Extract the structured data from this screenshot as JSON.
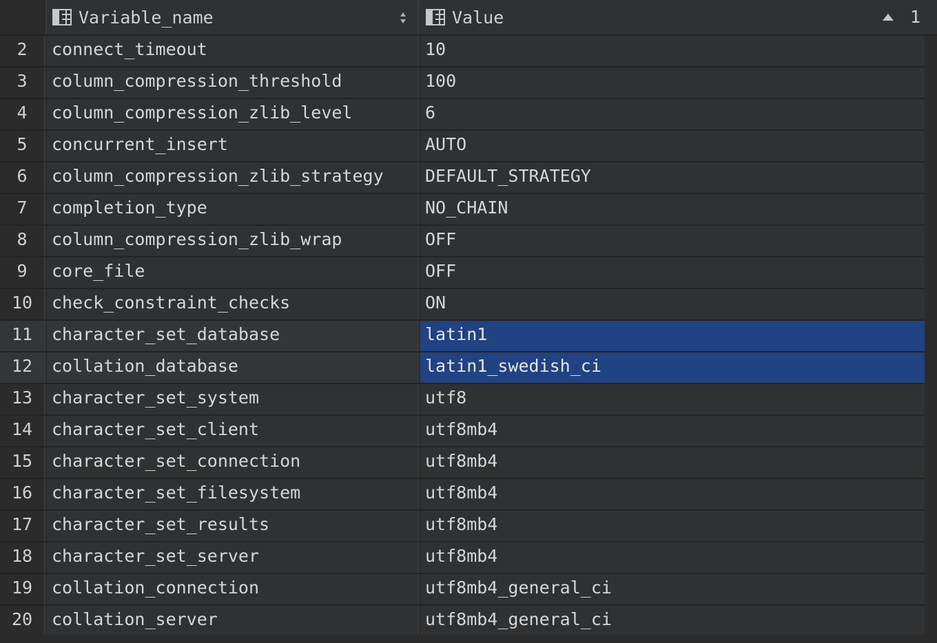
{
  "columns": {
    "name": {
      "label": "Variable_name",
      "icon": "table-column-icon"
    },
    "value": {
      "label": "Value",
      "icon": "table-column-icon",
      "sort_rank": "1",
      "sort_direction": "ascending"
    }
  },
  "colors": {
    "background": "#2b2b2b",
    "cell": "#2f3133",
    "selection": "#214283",
    "text": "#d6d6d6"
  },
  "rows": [
    {
      "num": "2",
      "name": "connect_timeout",
      "value": "10",
      "selected": false
    },
    {
      "num": "3",
      "name": "column_compression_threshold",
      "value": "100",
      "selected": false
    },
    {
      "num": "4",
      "name": "column_compression_zlib_level",
      "value": "6",
      "selected": false
    },
    {
      "num": "5",
      "name": "concurrent_insert",
      "value": "AUTO",
      "selected": false
    },
    {
      "num": "6",
      "name": "column_compression_zlib_strategy",
      "value": "DEFAULT_STRATEGY",
      "selected": false
    },
    {
      "num": "7",
      "name": "completion_type",
      "value": "NO_CHAIN",
      "selected": false
    },
    {
      "num": "8",
      "name": "column_compression_zlib_wrap",
      "value": "OFF",
      "selected": false
    },
    {
      "num": "9",
      "name": "core_file",
      "value": "OFF",
      "selected": false
    },
    {
      "num": "10",
      "name": "check_constraint_checks",
      "value": "ON",
      "selected": false
    },
    {
      "num": "11",
      "name": "character_set_database",
      "value": "latin1",
      "selected": true
    },
    {
      "num": "12",
      "name": "collation_database",
      "value": "latin1_swedish_ci",
      "selected": true
    },
    {
      "num": "13",
      "name": "character_set_system",
      "value": "utf8",
      "selected": false
    },
    {
      "num": "14",
      "name": "character_set_client",
      "value": "utf8mb4",
      "selected": false
    },
    {
      "num": "15",
      "name": "character_set_connection",
      "value": "utf8mb4",
      "selected": false
    },
    {
      "num": "16",
      "name": "character_set_filesystem",
      "value": "utf8mb4",
      "selected": false
    },
    {
      "num": "17",
      "name": "character_set_results",
      "value": "utf8mb4",
      "selected": false
    },
    {
      "num": "18",
      "name": "character_set_server",
      "value": "utf8mb4",
      "selected": false
    },
    {
      "num": "19",
      "name": "collation_connection",
      "value": "utf8mb4_general_ci",
      "selected": false
    },
    {
      "num": "20",
      "name": "collation_server",
      "value": "utf8mb4_general_ci",
      "selected": false
    }
  ]
}
